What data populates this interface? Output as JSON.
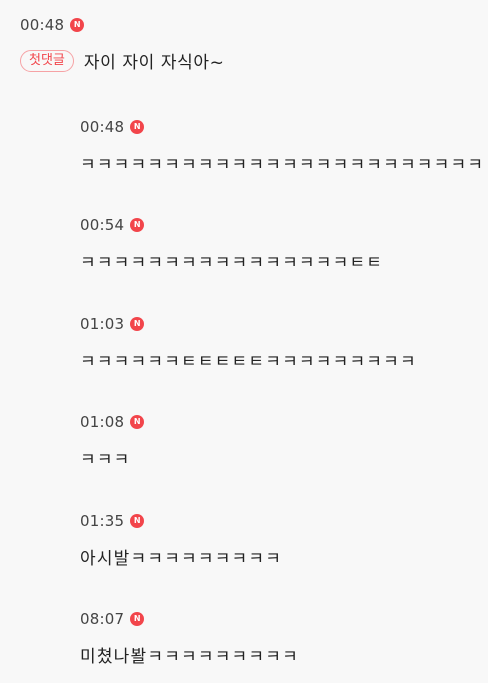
{
  "main_comment": {
    "time": "00:48",
    "new_badge": "N",
    "first_comment_tag": "첫댓글",
    "text": "자이 자이 자식아~"
  },
  "replies": [
    {
      "time": "00:48",
      "new_badge": "N",
      "text": "ㅋㅋㅋㅋㅋㅋㅋㅋㅋㅋㅋㅋㅋㅋㅋㅋㅋㅋㅋㅋㅋㅋㅋㅋ"
    },
    {
      "time": "00:54",
      "new_badge": "N",
      "text": "ㅋㅋㅋㅋㅋㅋㅋㅋㅋㅋㅋㅋㅋㅋㅋㅋㅌㅌ"
    },
    {
      "time": "01:03",
      "new_badge": "N",
      "text": "ㅋㅋㅋㅋㅋㅋㅌㅌㅌㅌㅌㅋㅋㅋㅋㅋㅋㅋㅋㅋ"
    },
    {
      "time": "01:08",
      "new_badge": "N",
      "text": "ㅋㅋㅋ"
    },
    {
      "time": "01:35",
      "new_badge": "N",
      "text": "아시발ㅋㅋㅋㅋㅋㅋㅋㅋㅋ"
    },
    {
      "time": "08:07",
      "new_badge": "N",
      "text": "미쳤나봘ㅋㅋㅋㅋㅋㅋㅋㅋㅋ"
    }
  ]
}
